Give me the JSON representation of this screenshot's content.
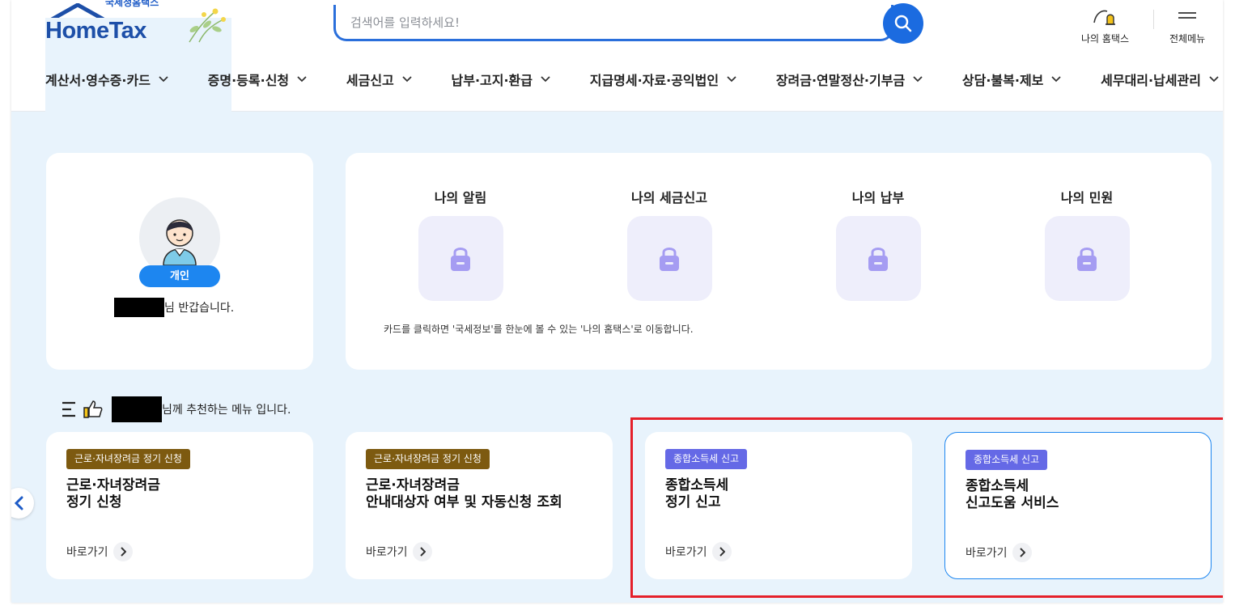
{
  "header": {
    "logo_sub": "국세청홈택스",
    "logo_main": "HomeTax",
    "search_placeholder": "검색어를 입력하세요!",
    "util_my": "나의 홈택스",
    "util_menu": "전체메뉴"
  },
  "gnb": [
    {
      "label": "계산서·영수증·카드"
    },
    {
      "label": "증명·등록·신청"
    },
    {
      "label": "세금신고"
    },
    {
      "label": "납부·고지·환급"
    },
    {
      "label": "지급명세·자료·공익법인"
    },
    {
      "label": "장려금·연말정산·기부금"
    },
    {
      "label": "상담·불복·제보"
    },
    {
      "label": "세무대리·납세관리"
    }
  ],
  "profile": {
    "badge": "개인",
    "greeting_suffix": "님 반갑습니다."
  },
  "my_area": {
    "items": [
      {
        "label": "나의 알림"
      },
      {
        "label": "나의 세금신고"
      },
      {
        "label": "나의 납부"
      },
      {
        "label": "나의 민원"
      }
    ],
    "note": "카드를 클릭하면 '국세정보'를 한눈에 볼 수 있는 '나의 홈택스'로 이동합니다."
  },
  "recommend": {
    "heading_suffix": "님께 추천하는 메뉴 입니다.",
    "goto_label": "바로가기",
    "cards": [
      {
        "tag": "근로·자녀장려금 정기 신청",
        "title_line1": "근로·자녀장려금",
        "title_line2": "정기 신청"
      },
      {
        "tag": "근로·자녀장려금 정기 신청",
        "title_line1": "근로·자녀장려금",
        "title_line2": "안내대상자 여부 및 자동신청 조회"
      },
      {
        "tag": "종합소득세 신고",
        "title_line1": "종합소득세",
        "title_line2": "정기 신고"
      },
      {
        "tag": "종합소득세 신고",
        "title_line1": "종합소득세",
        "title_line2": "신고도움 서비스"
      }
    ]
  },
  "colors": {
    "brand_blue": "#1b6be0",
    "brown_tag": "#7d5a10",
    "purple_tag": "#6569e6",
    "highlight_red": "#e5202a",
    "main_bg": "#e8f3fc"
  }
}
